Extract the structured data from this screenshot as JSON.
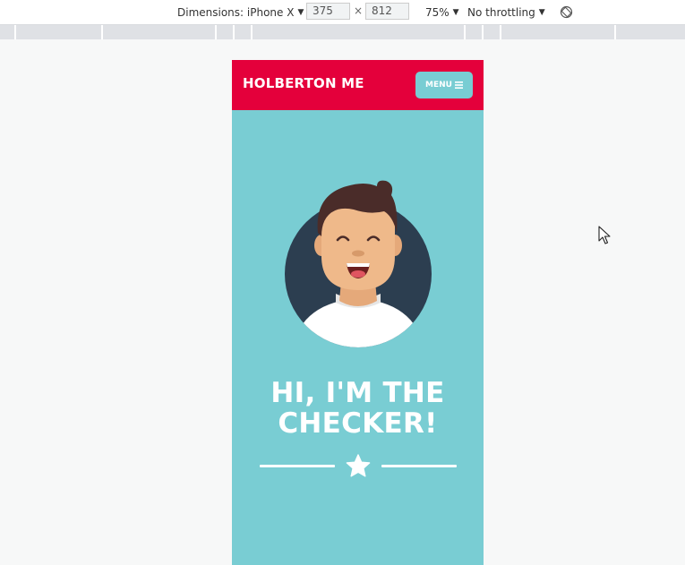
{
  "devtools": {
    "dimensions_label": "Dimensions: iPhone X",
    "width_value": "375",
    "height_value": "812",
    "times_symbol": "×",
    "zoom": "75%",
    "throttling": "No throttling",
    "caret": "▼"
  },
  "device": {
    "navbar": {
      "brand": "HOLBERTON ME",
      "menu_label": "MENU"
    },
    "hero": {
      "title_line1": "HI, I'M THE",
      "title_line2": "CHECKER!"
    }
  },
  "colors": {
    "navbar_bg": "#e4003b",
    "hero_bg": "#79cdd3",
    "avatar_circle": "#2c3e50",
    "text": "#ffffff"
  },
  "icons": [
    "hamburger-icon",
    "star-icon",
    "rotate-icon",
    "cursor-icon",
    "dropdown-caret-icon"
  ]
}
